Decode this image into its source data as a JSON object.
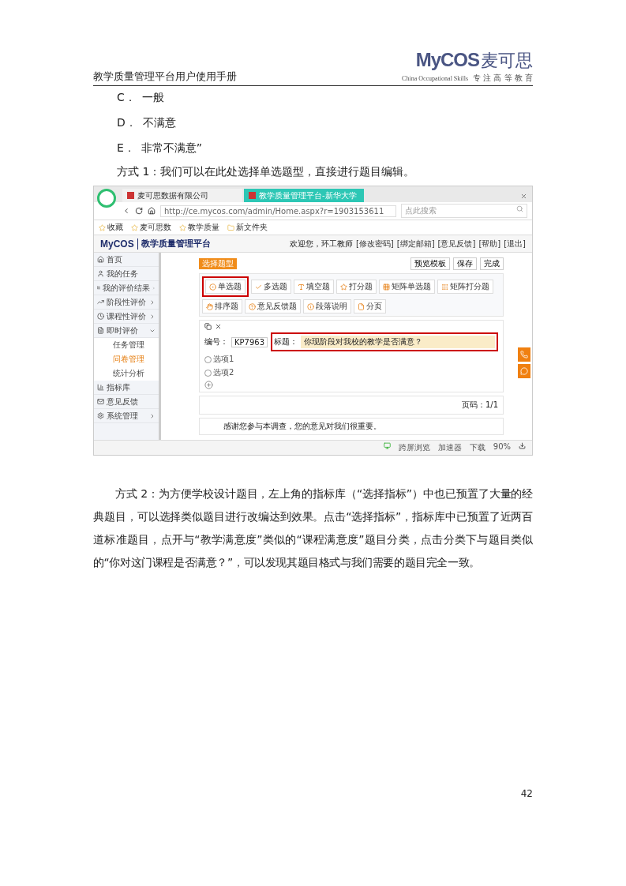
{
  "header": {
    "title": "教学质量管理平台用户使用手册",
    "logo": {
      "brand": "MyCOS",
      "name": "麦可思",
      "tagline_en": "China Occupational Skills",
      "tagline_cn": "专 注 高 等 教 育"
    }
  },
  "options": [
    {
      "letter": "C．",
      "text": "一般"
    },
    {
      "letter": "D．",
      "text": "不满意"
    },
    {
      "letter": "E．",
      "text": "非常不满意”"
    }
  ],
  "intro": "方式 1：我们可以在此处选择单选题型，直接进行题目编辑。",
  "screenshot": {
    "browser": {
      "tabs": [
        {
          "title": "麦可思数据有限公司",
          "selected": false
        },
        {
          "title": "教学质量管理平台-新华大学",
          "selected": true
        }
      ],
      "url": "http://ce.mycos.com/admin/Home.aspx?r=1903153611",
      "search_placeholder": "点此搜索",
      "bookmarks": [
        "收藏",
        "麦可思数",
        "教学质量",
        "新文件夹"
      ]
    },
    "app": {
      "brand": "MyCOS",
      "title": "教学质量管理平台",
      "welcome": "欢迎您，环工教师",
      "links": [
        "[修改密码]",
        "[绑定邮箱]",
        "[意见反馈]",
        "[帮助]",
        "[退出]"
      ]
    },
    "sidebar": [
      {
        "label": "首页"
      },
      {
        "label": "我的任务"
      },
      {
        "label": "我的评价结果",
        "expanded": false
      },
      {
        "label": "阶段性评价",
        "expanded": false
      },
      {
        "label": "课程性评价",
        "expanded": false
      },
      {
        "label": "即时评价",
        "expanded": true,
        "children": [
          {
            "label": "任务管理",
            "selected": false
          },
          {
            "label": "问卷管理",
            "selected": true
          },
          {
            "label": "统计分析",
            "selected": false
          }
        ]
      },
      {
        "label": "指标库"
      },
      {
        "label": "意见反馈"
      },
      {
        "label": "系统管理",
        "expanded": false
      }
    ],
    "toolbar_buttons": [
      "预览模板",
      "保存",
      "完成"
    ],
    "section_tag": "选择题型",
    "question_types": [
      {
        "label": "单选题",
        "highlighted": true
      },
      {
        "label": "多选题",
        "highlighted": false
      },
      {
        "label": "填空题",
        "highlighted": false
      },
      {
        "label": "打分题",
        "highlighted": false
      },
      {
        "label": "矩阵单选题",
        "highlighted": false
      },
      {
        "label": "矩阵打分题",
        "highlighted": false
      },
      {
        "label": "排序题",
        "highlighted": false
      },
      {
        "label": "意见反馈题",
        "highlighted": false
      },
      {
        "label": "段落说明",
        "highlighted": false
      },
      {
        "label": "分页",
        "highlighted": false
      }
    ],
    "editor": {
      "number_label": "编号：",
      "number": "KP7963",
      "title_label": "标题：",
      "title": "你现阶段对我校的教学是否满意？",
      "title_highlighted": true,
      "options": [
        "选项1",
        "选项2"
      ]
    },
    "page_info": "页码：1/1",
    "footer_note": "感谢您参与本调查，您的意见对我们很重要。",
    "status_bar": [
      "跨屏浏览",
      "加速器",
      "下载",
      "90%"
    ]
  },
  "paragraph": "方式 2：为方便学校设计题目，左上角的指标库（“选择指标”）中也已预置了大量的经典题目，可以选择类似题目进行改编达到效果。点击“选择指标”，指标库中已预置了近两百道标准题目，点开与“教学满意度”类似的“课程满意度”题目分类，点击分类下与题目类似的“你对这门课程是否满意？”，可以发现其题目格式与我们需要的题目完全一致。",
  "page_number": "42"
}
